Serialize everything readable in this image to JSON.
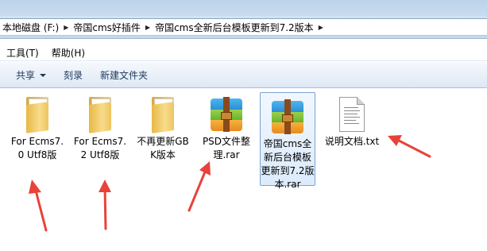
{
  "breadcrumb": {
    "items": [
      "本地磁盘 (F:)",
      "帝国cms好插件",
      "帝国cms全新后台模板更新到7.2版本"
    ]
  },
  "menu": {
    "items": [
      "工具(T)",
      "帮助(H)"
    ]
  },
  "toolbar": {
    "share_label": "共享",
    "burn_label": "刻录",
    "new_folder_label": "新建文件夹"
  },
  "files": [
    {
      "name": "For Ecms7.0 Utf8版",
      "type": "folder",
      "icon": "folder-icon",
      "selected": false
    },
    {
      "name": "For Ecms7.2 Utf8版",
      "type": "folder",
      "icon": "folder-icon",
      "selected": false
    },
    {
      "name": "不再更新GBK版本",
      "type": "folder",
      "icon": "folder-icon",
      "selected": false
    },
    {
      "name": "PSD文件整理.rar",
      "type": "archive",
      "icon": "winrar-archive-icon",
      "selected": false
    },
    {
      "name": "帝国cms全新后台模板更新到7.2版本.rar",
      "type": "archive",
      "icon": "winrar-archive-icon",
      "selected": true
    },
    {
      "name": "说明文档.txt",
      "type": "text",
      "icon": "text-document-icon",
      "selected": false
    }
  ],
  "colors": {
    "annotation_arrow": "#e8423a",
    "selection_border": "#7da2ce",
    "toolbar_text": "#1e395b"
  }
}
